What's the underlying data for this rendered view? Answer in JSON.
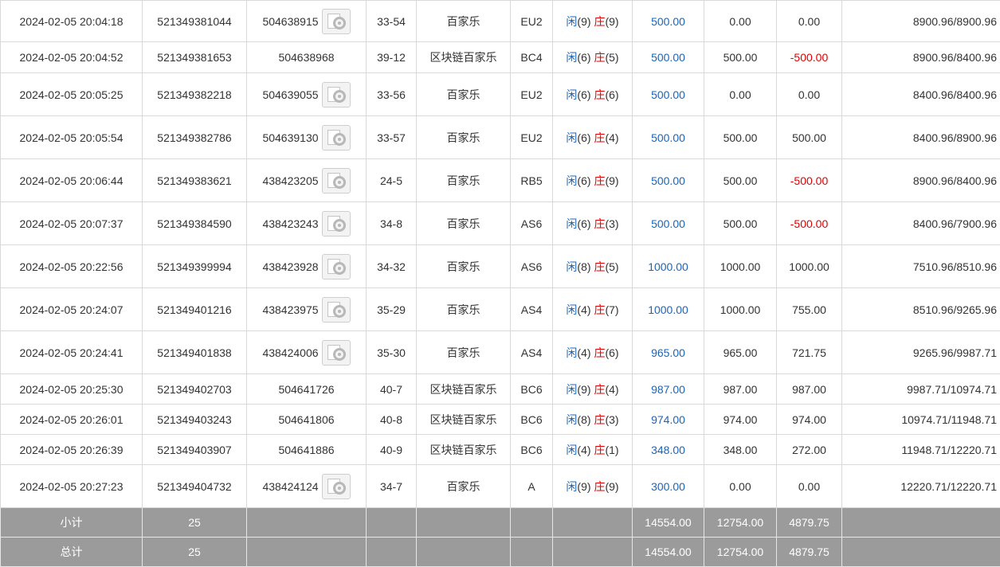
{
  "rows": [
    {
      "time": "2024-02-05 20:04:18",
      "order": "521349381044",
      "round": "504638915",
      "video": true,
      "table": "33-54",
      "game": "百家乐",
      "room": "EU2",
      "player_label": "闲",
      "player": "(9)",
      "banker_label": "庄",
      "banker": "(9)",
      "bet": "500.00",
      "valid": "0.00",
      "win": "0.00",
      "win_color": "normal",
      "balance": "8900.96/8900.96"
    },
    {
      "time": "2024-02-05 20:04:52",
      "order": "521349381653",
      "round": "504638968",
      "video": false,
      "table": "39-12",
      "game": "区块链百家乐",
      "room": "BC4",
      "player_label": "闲",
      "player": "(6)",
      "banker_label": "庄",
      "banker": "(5)",
      "bet": "500.00",
      "valid": "500.00",
      "win": "-500.00",
      "win_color": "red",
      "balance": "8900.96/8400.96"
    },
    {
      "time": "2024-02-05 20:05:25",
      "order": "521349382218",
      "round": "504639055",
      "video": true,
      "table": "33-56",
      "game": "百家乐",
      "room": "EU2",
      "player_label": "闲",
      "player": "(6)",
      "banker_label": "庄",
      "banker": "(6)",
      "bet": "500.00",
      "valid": "0.00",
      "win": "0.00",
      "win_color": "normal",
      "balance": "8400.96/8400.96"
    },
    {
      "time": "2024-02-05 20:05:54",
      "order": "521349382786",
      "round": "504639130",
      "video": true,
      "table": "33-57",
      "game": "百家乐",
      "room": "EU2",
      "player_label": "闲",
      "player": "(6)",
      "banker_label": "庄",
      "banker": "(4)",
      "bet": "500.00",
      "valid": "500.00",
      "win": "500.00",
      "win_color": "normal",
      "balance": "8400.96/8900.96"
    },
    {
      "time": "2024-02-05 20:06:44",
      "order": "521349383621",
      "round": "438423205",
      "video": true,
      "table": "24-5",
      "game": "百家乐",
      "room": "RB5",
      "player_label": "闲",
      "player": "(6)",
      "banker_label": "庄",
      "banker": "(9)",
      "bet": "500.00",
      "valid": "500.00",
      "win": "-500.00",
      "win_color": "red",
      "balance": "8900.96/8400.96"
    },
    {
      "time": "2024-02-05 20:07:37",
      "order": "521349384590",
      "round": "438423243",
      "video": true,
      "table": "34-8",
      "game": "百家乐",
      "room": "AS6",
      "player_label": "闲",
      "player": "(6)",
      "banker_label": "庄",
      "banker": "(3)",
      "bet": "500.00",
      "valid": "500.00",
      "win": "-500.00",
      "win_color": "red",
      "balance": "8400.96/7900.96"
    },
    {
      "time": "2024-02-05 20:22:56",
      "order": "521349399994",
      "round": "438423928",
      "video": true,
      "table": "34-32",
      "game": "百家乐",
      "room": "AS6",
      "player_label": "闲",
      "player": "(8)",
      "banker_label": "庄",
      "banker": "(5)",
      "bet": "1000.00",
      "valid": "1000.00",
      "win": "1000.00",
      "win_color": "normal",
      "balance": "7510.96/8510.96"
    },
    {
      "time": "2024-02-05 20:24:07",
      "order": "521349401216",
      "round": "438423975",
      "video": true,
      "table": "35-29",
      "game": "百家乐",
      "room": "AS4",
      "player_label": "闲",
      "player": "(4)",
      "banker_label": "庄",
      "banker": "(7)",
      "bet": "1000.00",
      "valid": "1000.00",
      "win": "755.00",
      "win_color": "normal",
      "balance": "8510.96/9265.96"
    },
    {
      "time": "2024-02-05 20:24:41",
      "order": "521349401838",
      "round": "438424006",
      "video": true,
      "table": "35-30",
      "game": "百家乐",
      "room": "AS4",
      "player_label": "闲",
      "player": "(4)",
      "banker_label": "庄",
      "banker": "(6)",
      "bet": "965.00",
      "valid": "965.00",
      "win": "721.75",
      "win_color": "normal",
      "balance": "9265.96/9987.71"
    },
    {
      "time": "2024-02-05 20:25:30",
      "order": "521349402703",
      "round": "504641726",
      "video": false,
      "table": "40-7",
      "game": "区块链百家乐",
      "room": "BC6",
      "player_label": "闲",
      "player": "(9)",
      "banker_label": "庄",
      "banker": "(4)",
      "bet": "987.00",
      "valid": "987.00",
      "win": "987.00",
      "win_color": "normal",
      "balance": "9987.71/10974.71"
    },
    {
      "time": "2024-02-05 20:26:01",
      "order": "521349403243",
      "round": "504641806",
      "video": false,
      "table": "40-8",
      "game": "区块链百家乐",
      "room": "BC6",
      "player_label": "闲",
      "player": "(8)",
      "banker_label": "庄",
      "banker": "(3)",
      "bet": "974.00",
      "valid": "974.00",
      "win": "974.00",
      "win_color": "normal",
      "balance": "10974.71/11948.71"
    },
    {
      "time": "2024-02-05 20:26:39",
      "order": "521349403907",
      "round": "504641886",
      "video": false,
      "table": "40-9",
      "game": "区块链百家乐",
      "room": "BC6",
      "player_label": "闲",
      "player": "(4)",
      "banker_label": "庄",
      "banker": "(1)",
      "bet": "348.00",
      "valid": "348.00",
      "win": "272.00",
      "win_color": "normal",
      "balance": "11948.71/12220.71"
    },
    {
      "time": "2024-02-05 20:27:23",
      "order": "521349404732",
      "round": "438424124",
      "video": true,
      "table": "34-7",
      "game": "百家乐",
      "room": "A",
      "player_label": "闲",
      "player": "(9)",
      "banker_label": "庄",
      "banker": "(9)",
      "bet": "300.00",
      "valid": "0.00",
      "win": "0.00",
      "win_color": "normal",
      "balance": "12220.71/12220.71"
    }
  ],
  "subtotal": {
    "label": "小计",
    "count": "25",
    "bet": "14554.00",
    "valid": "12754.00",
    "win": "4879.75"
  },
  "total": {
    "label": "总计",
    "count": "25",
    "bet": "14554.00",
    "valid": "12754.00",
    "win": "4879.75"
  },
  "colors": {
    "bet": "#1a65b8",
    "loss": "#e00000",
    "player": "#1a65b8",
    "banker": "#e00000",
    "summary_bg": "#9b9b9b"
  }
}
